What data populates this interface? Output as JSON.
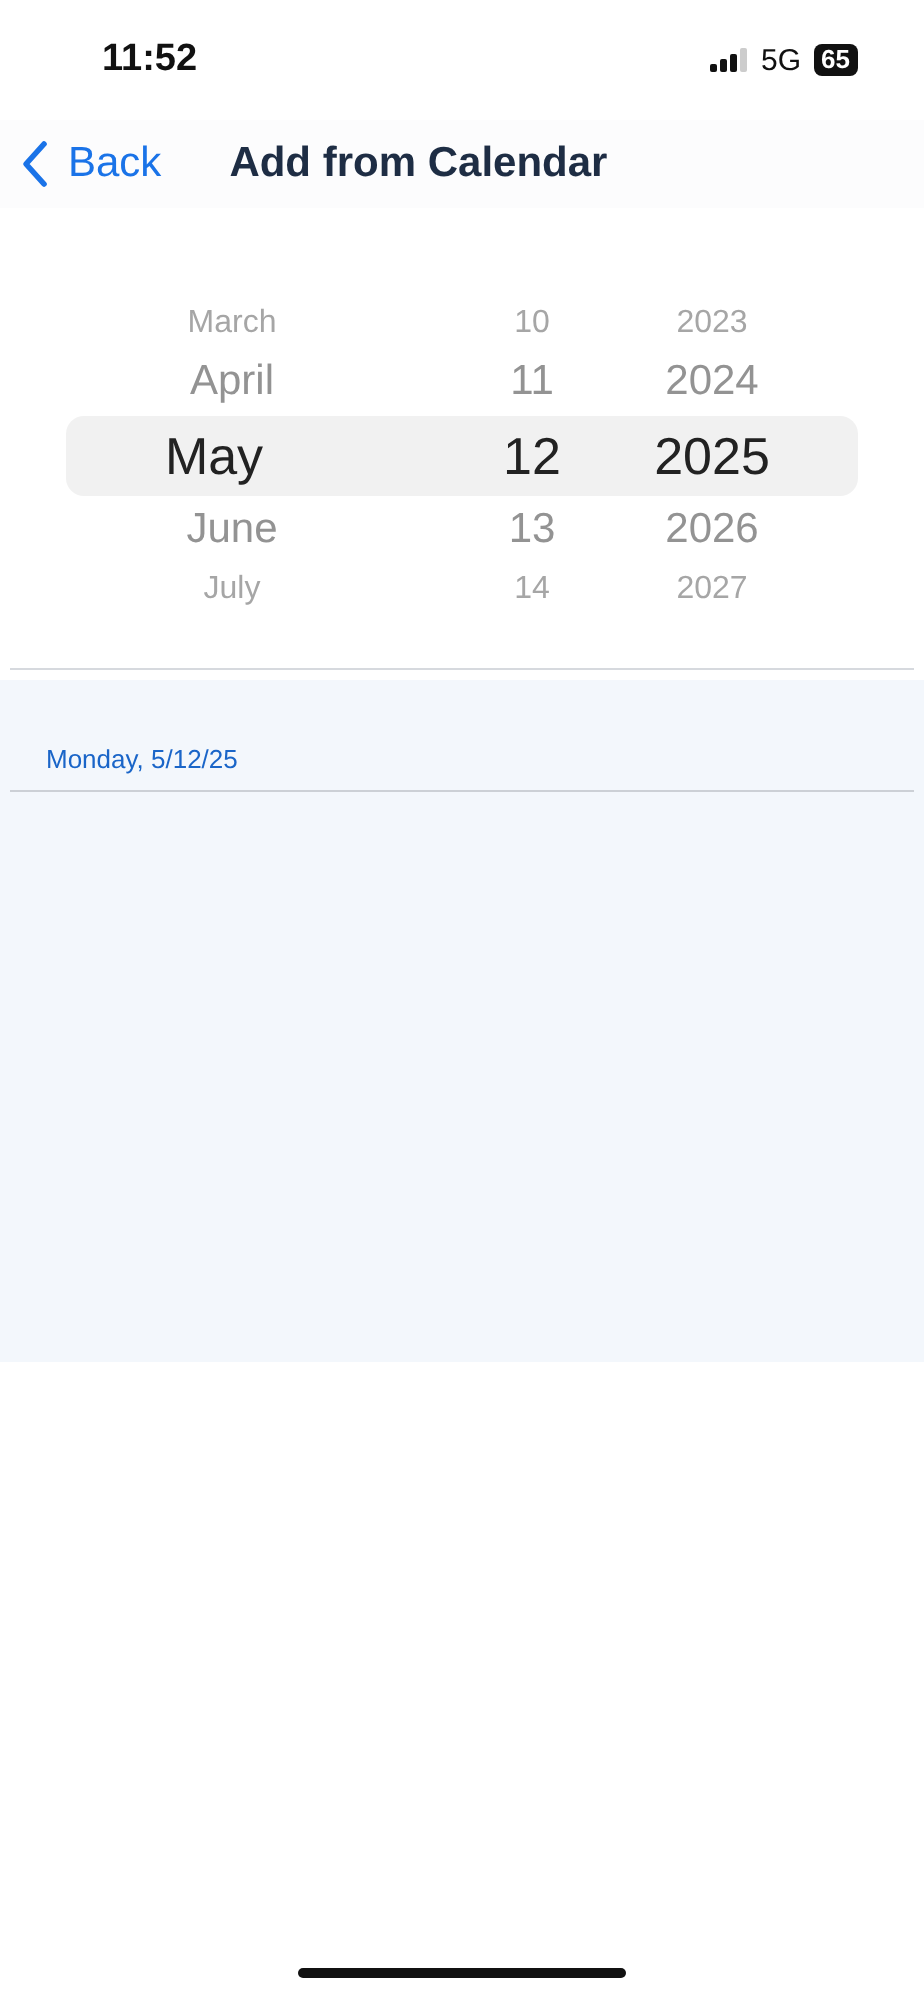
{
  "status_bar": {
    "time": "11:52",
    "network": "5G",
    "battery": "65"
  },
  "nav": {
    "back": "Back",
    "title": "Add from Calendar"
  },
  "picker": {
    "columns": [
      {
        "kind": "month",
        "items": [
          {
            "label": "March",
            "selected": false
          },
          {
            "label": "April",
            "selected": false
          },
          {
            "label": "May",
            "selected": true
          },
          {
            "label": "June",
            "selected": false
          },
          {
            "label": "July",
            "selected": false
          }
        ]
      },
      {
        "kind": "day",
        "items": [
          {
            "label": "10",
            "selected": false
          },
          {
            "label": "11",
            "selected": false
          },
          {
            "label": "12",
            "selected": true
          },
          {
            "label": "13",
            "selected": false
          },
          {
            "label": "14",
            "selected": false
          }
        ]
      },
      {
        "kind": "year",
        "items": [
          {
            "label": "2023",
            "selected": false
          },
          {
            "label": "2024",
            "selected": false
          },
          {
            "label": "2025",
            "selected": true
          },
          {
            "label": "2026",
            "selected": false
          },
          {
            "label": "2027",
            "selected": false
          }
        ]
      }
    ]
  },
  "date_header": "Monday, 5/12/25"
}
